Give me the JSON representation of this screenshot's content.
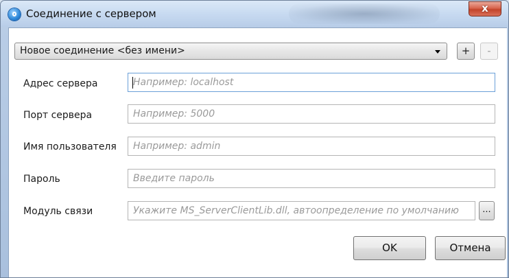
{
  "window": {
    "title": "Соединение с сервером",
    "close_label": "x"
  },
  "connection": {
    "selected": "Новое соединение <без имени>",
    "add_label": "+",
    "remove_label": "-"
  },
  "fields": {
    "address": {
      "label": "Адрес сервера",
      "placeholder": "Например: localhost",
      "value": ""
    },
    "port": {
      "label": "Порт сервера",
      "placeholder": "Например: 5000",
      "value": ""
    },
    "username": {
      "label": "Имя пользователя",
      "placeholder": "Например: admin",
      "value": ""
    },
    "password": {
      "label": "Пароль",
      "placeholder": "Введите пароль",
      "value": ""
    },
    "module": {
      "label": "Модуль связи",
      "placeholder": "Укажите MS_ServerClientLib.dll, автоопределение по умолчанию",
      "value": ""
    }
  },
  "browse_label": "...",
  "buttons": {
    "ok": "OK",
    "cancel": "Отмена"
  },
  "icons": {
    "app": "server-connection-icon",
    "close": "close-icon",
    "dropdown": "chevron-down-icon"
  },
  "colors": {
    "close_button": "#c3442b",
    "focus_border": "#6a9fd8",
    "placeholder": "#9a9a9a"
  }
}
